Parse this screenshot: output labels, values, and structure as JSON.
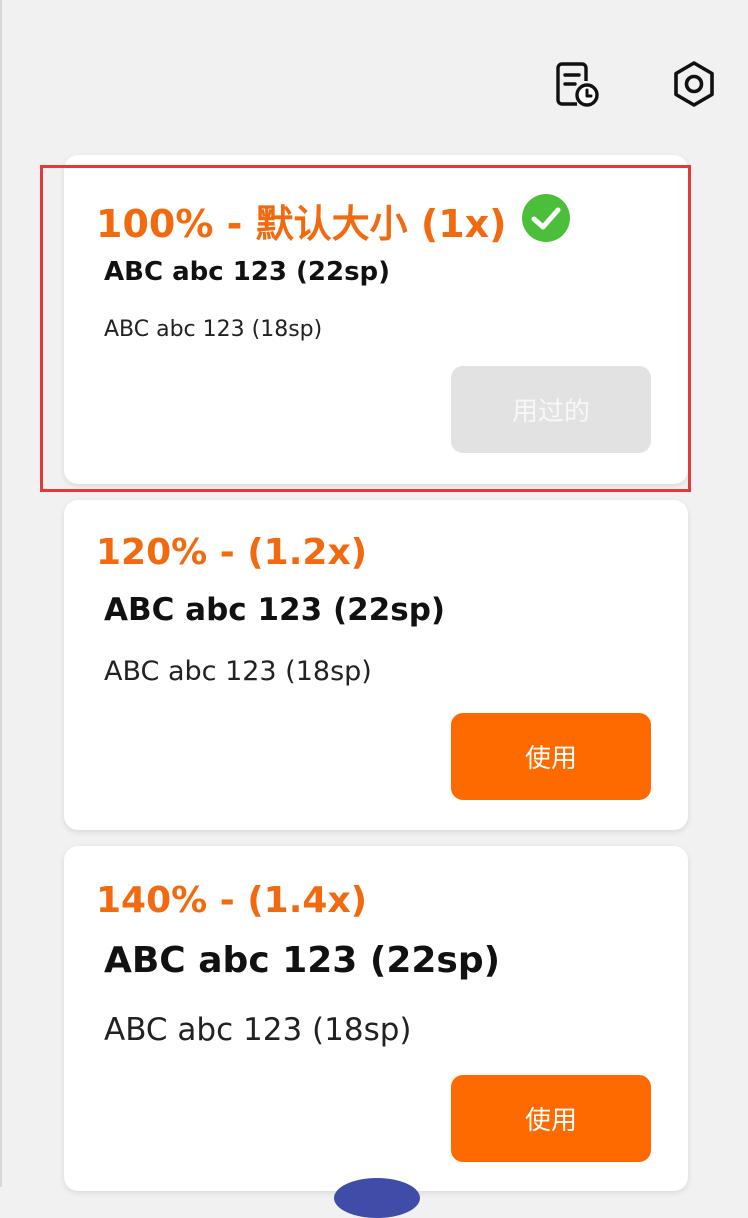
{
  "topbar": {
    "history_icon": "history-doc-clock-icon",
    "settings_icon": "hexagon-settings-icon"
  },
  "options": [
    {
      "title": "100% - 默认大小 (1x)",
      "sample_large": "ABC abc 123 (22sp)",
      "sample_small": "ABC abc 123 (18sp)",
      "button_label": "用过的",
      "selected": true
    },
    {
      "title": "120% - (1.2x)",
      "sample_large": "ABC abc 123 (22sp)",
      "sample_small": "ABC abc 123 (18sp)",
      "button_label": "使用",
      "selected": false
    },
    {
      "title": "140% - (1.4x)",
      "sample_large": "ABC abc 123 (22sp)",
      "sample_small": "ABC abc 123 (18sp)",
      "button_label": "使用",
      "selected": false
    }
  ],
  "colors": {
    "accent": "#f26a0f",
    "button_active": "#ff6a00",
    "button_used": "#e2e2e2",
    "check": "#4cbf3a",
    "highlight": "#e2393c"
  }
}
